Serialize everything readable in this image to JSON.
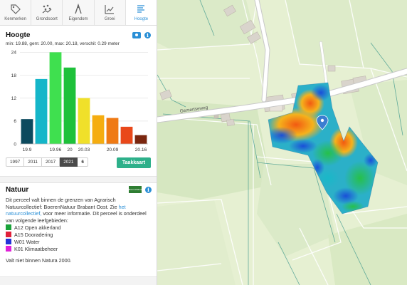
{
  "tabs": [
    {
      "label": "Kenmerken",
      "icon": "tag-icon"
    },
    {
      "label": "Grondsoort",
      "icon": "soil-icon"
    },
    {
      "label": "Eigendom",
      "icon": "ownership-icon"
    },
    {
      "label": "Groei",
      "icon": "growth-chart-icon"
    },
    {
      "label": "Hoogte",
      "icon": "height-list-icon"
    }
  ],
  "active_tab": "Hoogte",
  "hoogte": {
    "title": "Hoogte",
    "stats": "min: 19.88, gem: 20.00, max: 20.18, verschil: 0.29 meter"
  },
  "chart_data": {
    "type": "bar",
    "values": [
      6.5,
      17,
      24,
      20,
      12,
      7.5,
      6.8,
      4.5,
      2.3
    ],
    "colors": [
      "#0c4a5e",
      "#15b6c9",
      "#3fe04f",
      "#1ec13a",
      "#f0e02a",
      "#f5ad10",
      "#ef7a14",
      "#e9481a",
      "#7a260f"
    ],
    "x_tick_labels": [
      "19.9",
      "19.96",
      "20",
      "20.03",
      "20.09",
      "20.16"
    ],
    "x_tick_positions": [
      0,
      2,
      3,
      4,
      6,
      8
    ],
    "y_ticks": [
      0,
      6,
      12,
      18,
      24
    ],
    "ylim": [
      0,
      25
    ],
    "grid": true
  },
  "years": [
    "1997",
    "2011",
    "2017",
    "2021"
  ],
  "active_year": "2021",
  "more_label": "6",
  "taakkaart_label": "Taakkaart",
  "natuur": {
    "title": "Natuur",
    "logo_text": "BoerenNatuur",
    "text_before": "Dit perceel valt binnen de grenzen van Agrarisch Natuurcollectief: BoerenNatuur Brabant Oost. Zie ",
    "link_text": "het natuurcollectief,",
    "text_after": " voor meer informatie. Dit perceel is onderdeel van volgende leefgebieden:",
    "legend": [
      {
        "label": "A12 Open akkerland",
        "color": "#1aa33a"
      },
      {
        "label": "A15 Dooradering",
        "color": "#e0203a"
      },
      {
        "label": "W01 Water",
        "color": "#2233d8"
      },
      {
        "label": "K01 Klimaatbeheer",
        "color": "#e020d8"
      }
    ],
    "natura": "Valt niet binnen Natura 2000."
  },
  "map": {
    "road_label": "Gemertseweg"
  }
}
